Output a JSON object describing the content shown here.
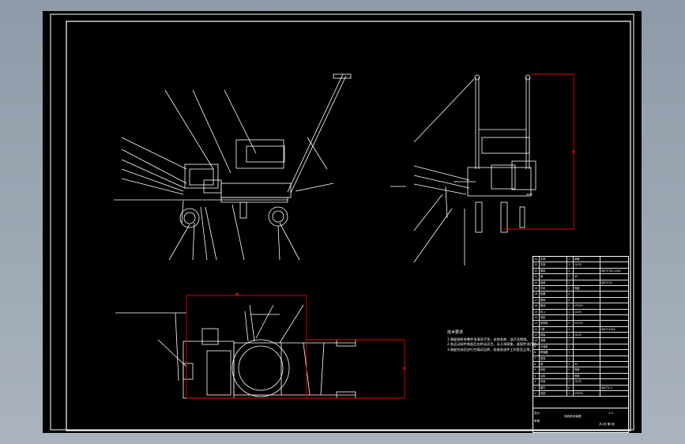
{
  "drawing": {
    "notes": {
      "title": "技术要求",
      "lines": [
        "1.装配前所有零件须清洗干净，去除毛刺、油污及锈蚀。",
        "2.各运动部件装配后应转动灵活，无卡滞现象，紧固件须拧紧。",
        "3.装配完成后进行空载试运转，检查各部件工作是否正常。"
      ]
    },
    "bom": {
      "rows": [
        [
          "24",
          "手柄",
          "1",
          "钢管",
          ""
        ],
        [
          "23",
          "支架",
          "1",
          "Q235",
          ""
        ],
        [
          "22",
          "螺栓",
          "4",
          "",
          "GB/T5782-2000"
        ],
        [
          "21",
          "轴",
          "1",
          "45",
          ""
        ],
        [
          "20",
          "轴承",
          "2",
          "",
          "GB/T276"
        ],
        [
          "19",
          "车轮",
          "2",
          "橡胶",
          ""
        ],
        [
          "18",
          "垫圈",
          "4",
          "",
          ""
        ],
        [
          "17",
          "螺母",
          "4",
          "",
          ""
        ],
        [
          "16",
          "箱体",
          "1",
          "HT200",
          ""
        ],
        [
          "15",
          "料斗",
          "1",
          "Q235",
          ""
        ],
        [
          "14",
          "电机",
          "1",
          "",
          ""
        ],
        [
          "13",
          "皮带轮",
          "2",
          "HT150",
          ""
        ],
        [
          "12",
          "V带",
          "1",
          "",
          "GB/T11544"
        ],
        [
          "11",
          "底板",
          "1",
          "Q235",
          ""
        ],
        [
          "10",
          "油箱",
          "1",
          "",
          ""
        ],
        [
          "9",
          "汽油机",
          "1",
          "",
          ""
        ],
        [
          "8",
          "联轴器",
          "1",
          "",
          ""
        ],
        [
          "7",
          "罩壳",
          "1",
          "",
          ""
        ],
        [
          "6",
          "销",
          "2",
          "45",
          ""
        ],
        [
          "5",
          "前轮",
          "2",
          "橡胶",
          ""
        ],
        [
          "4",
          "后轮",
          "2",
          "橡胶",
          ""
        ],
        [
          "3",
          "车架",
          "1",
          "Q235",
          ""
        ],
        [
          "2",
          "螺钉",
          "6",
          "",
          "GB/T70.1"
        ],
        [
          "1",
          "机座",
          "1",
          "HT200",
          ""
        ]
      ]
    },
    "title_block": {
      "name": "划线机总装图",
      "scale": "1:5",
      "sheet": "共1张 第1张",
      "drawn": "设计",
      "checked": "审核"
    }
  }
}
